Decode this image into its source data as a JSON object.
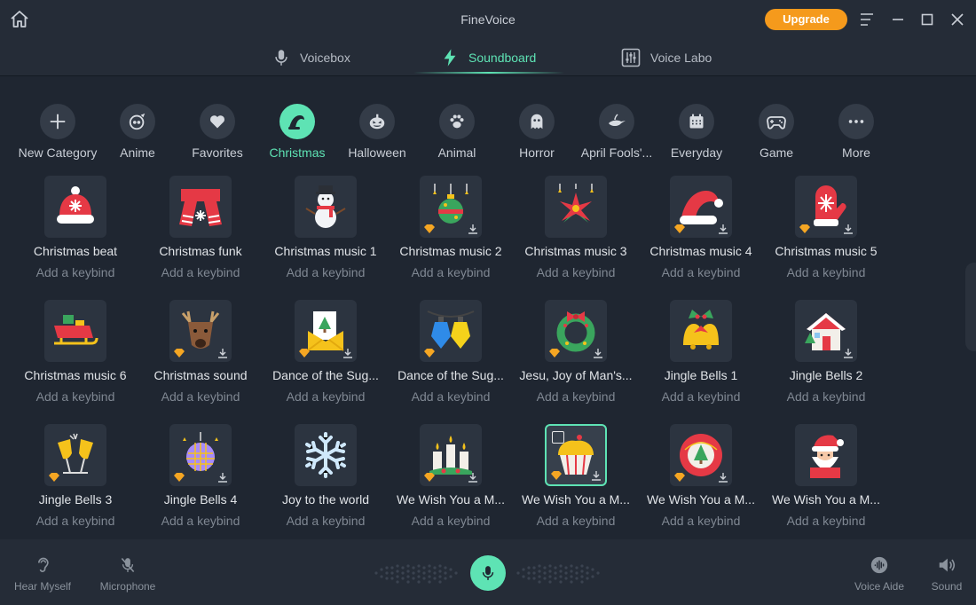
{
  "titlebar": {
    "app_title": "FineVoice",
    "upgrade_label": "Upgrade"
  },
  "nav": {
    "tabs": [
      {
        "label": "Voicebox",
        "icon": "microphone-icon",
        "active": false
      },
      {
        "label": "Soundboard",
        "icon": "lightning-icon",
        "active": true
      },
      {
        "label": "Voice Labo",
        "icon": "sliders-icon",
        "active": false
      }
    ]
  },
  "categories": [
    {
      "label": "New Category",
      "icon": "plus-icon"
    },
    {
      "label": "Anime",
      "icon": "anime-icon"
    },
    {
      "label": "Favorites",
      "icon": "heart-icon"
    },
    {
      "label": "Christmas",
      "icon": "santa-hat-icon",
      "active": true
    },
    {
      "label": "Halloween",
      "icon": "pumpkin-icon"
    },
    {
      "label": "Animal",
      "icon": "paw-icon"
    },
    {
      "label": "Horror",
      "icon": "ghost-icon"
    },
    {
      "label": "April Fools'...",
      "icon": "genie-lamp-icon"
    },
    {
      "label": "Everyday",
      "icon": "calendar-icon"
    },
    {
      "label": "Game",
      "icon": "gamepad-icon"
    },
    {
      "label": "More",
      "icon": "more-dots-icon"
    }
  ],
  "keybind_placeholder": "Add a keybind",
  "sounds": [
    {
      "name": "Christmas beat",
      "icon": "santa-hat-snowflake-icon"
    },
    {
      "name": "Christmas funk",
      "icon": "scarf-icon"
    },
    {
      "name": "Christmas music 1",
      "icon": "snowman-icon"
    },
    {
      "name": "Christmas music 2",
      "icon": "ornament-icon"
    },
    {
      "name": "Christmas music 3",
      "icon": "poinsettia-icon"
    },
    {
      "name": "Christmas music 4",
      "icon": "santa-hat-icon"
    },
    {
      "name": "Christmas music 5",
      "icon": "mitten-icon"
    },
    {
      "name": "Christmas music 6",
      "icon": "sleigh-icon"
    },
    {
      "name": "Christmas sound",
      "icon": "reindeer-icon"
    },
    {
      "name": "Dance of the Sug...",
      "icon": "christmas-card-icon"
    },
    {
      "name": "Dance of the Sug...",
      "icon": "lights-icon"
    },
    {
      "name": "Jesu, Joy of Man's...",
      "icon": "wreath-icon"
    },
    {
      "name": "Jingle Bells 1",
      "icon": "bells-icon"
    },
    {
      "name": "Jingle Bells 2",
      "icon": "snow-house-icon"
    },
    {
      "name": "Jingle Bells 3",
      "icon": "champagne-icon"
    },
    {
      "name": "Jingle Bells 4",
      "icon": "disco-ball-icon"
    },
    {
      "name": "Joy to the world",
      "icon": "snowflake-icon"
    },
    {
      "name": "We Wish You a M...",
      "icon": "candles-icon"
    },
    {
      "name": "We Wish You a M...",
      "icon": "cupcake-icon",
      "selected": true
    },
    {
      "name": "We Wish You a M...",
      "icon": "merry-christmas-badge-icon"
    },
    {
      "name": "We Wish You a M...",
      "icon": "santa-icon"
    }
  ],
  "bottom": {
    "hear_myself": "Hear Myself",
    "microphone": "Microphone",
    "voice_aide": "Voice Aide",
    "sound": "Sound"
  },
  "colors": {
    "accent": "#5ee3b4",
    "upgrade": "#f59a1c",
    "background": "#1f2631"
  }
}
